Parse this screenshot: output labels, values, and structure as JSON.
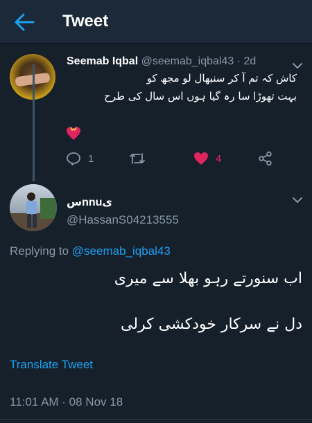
{
  "header": {
    "title": "Tweet",
    "back_icon": "arrow-left-icon"
  },
  "colors": {
    "background": "#15202b",
    "header": "#1c2938",
    "accent": "#1da1f2",
    "secondary_text": "#8899a6",
    "like": "#e0245e"
  },
  "parent_tweet": {
    "name": "Seemab Iqbal",
    "handle": "@seemab_iqbal43",
    "time": "· 2d",
    "lines": [
      "کاش کہ تم آ کر سنبھال لو مجھ کو",
      "بہت تھوڑا سا رہ گیا ہوں اس سال کی طرح"
    ],
    "emoji": "heart-with-ribbon",
    "actions": {
      "replies": "1",
      "retweets": "",
      "likes": "4",
      "liked": true
    }
  },
  "reply_tweet": {
    "name": "سnnuی",
    "handle": "@HassanS04213555",
    "replying_label": "Replying to ",
    "replying_to": "@seemab_iqbal43",
    "lines": [
      "اب سنورتے رہو بھلا سے میری",
      "دل نے سرکار خودکشی کرلی"
    ],
    "translate": "Translate Tweet",
    "timestamp": "11:01 AM · 08 Nov 18"
  }
}
